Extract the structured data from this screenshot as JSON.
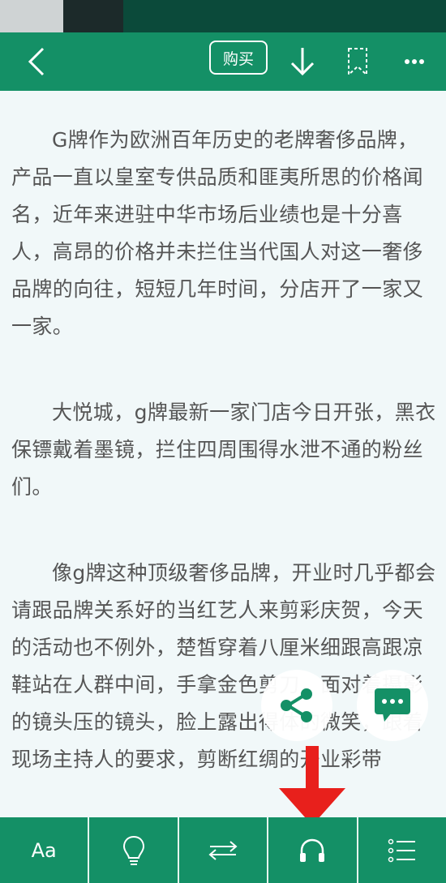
{
  "top_bar": {
    "back_icon": "chevron-left-icon",
    "buy_label": "购买",
    "download_icon": "arrow-down-icon",
    "bookmark_icon": "bookmark-icon",
    "more_icon": "more-dots-icon"
  },
  "content": {
    "paragraphs": [
      "G牌作为欧洲百年历史的老牌奢侈品牌，产品一直以皇室专供品质和匪夷所思的价格闻名，近年来进驻中华市场后业绩也是十分喜人，高昂的价格并未拦住当代国人对这一奢侈品牌的向往，短短几年时间，分店开了一家又一家。",
      "大悦城，g牌最新一家门店今日开张，黑衣保镖戴着墨镜，拦住四周围得水泄不通的粉丝们。",
      "像g牌这种顶级奢侈品牌，开业时几乎都会请跟品牌关系好的当红艺人来剪彩庆贺，今天的活动也不例外，楚皙穿着八厘米细跟高跟凉鞋站在人群中间，手拿金色剪刀，面对着摄影的镜头压的镜头，脸上露出得体的微笑，跟着现场主持人的要求，剪断红绸的开业彩带"
    ]
  },
  "floating": {
    "share_icon": "share-icon",
    "comment_icon": "comment-icon",
    "arrow_icon": "red-down-arrow-icon"
  },
  "bottom_bar": {
    "font_label": "Aa",
    "light_icon": "lightbulb-icon",
    "switch_icon": "swap-arrows-icon",
    "listen_icon": "headphones-icon",
    "toc_icon": "list-icon"
  },
  "colors": {
    "accent": "#149066",
    "status_bar": "#0b4a3a",
    "page_bg": "#f1f8f9",
    "text": "#555555",
    "arrow": "#e8201c"
  }
}
